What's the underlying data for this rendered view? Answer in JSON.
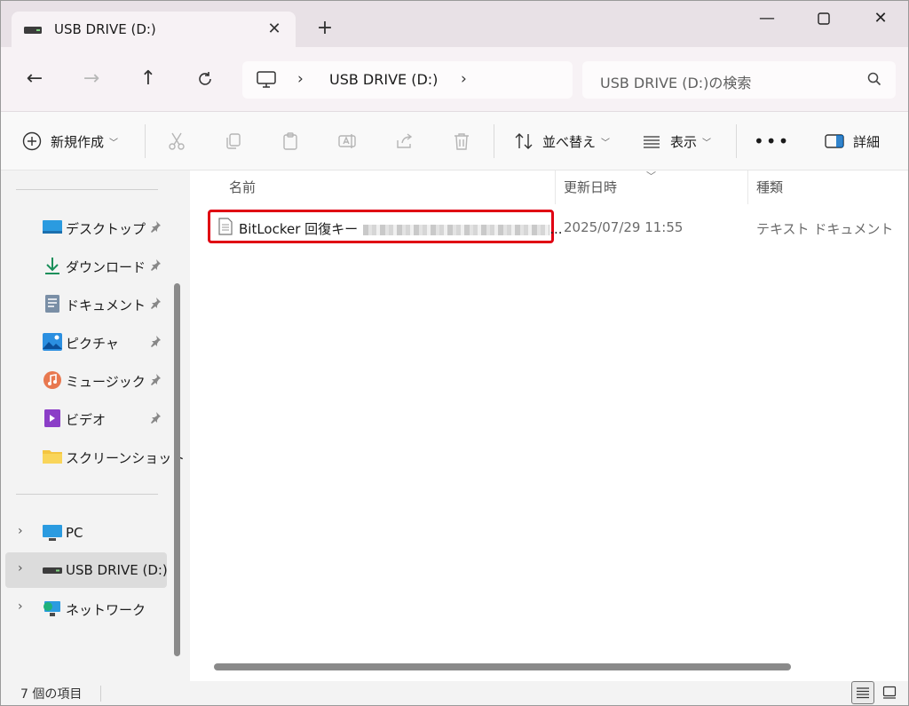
{
  "tab": {
    "title": "USB DRIVE (D:)"
  },
  "address": {
    "path": "USB DRIVE (D:)",
    "search_placeholder": "USB DRIVE (D:)の検索"
  },
  "toolbar": {
    "new": "新規作成",
    "sort": "並べ替え",
    "view": "表示",
    "details": "詳細"
  },
  "sidebar": {
    "quick": [
      {
        "label": "デスクトップ",
        "icon": "desktop-icon"
      },
      {
        "label": "ダウンロード",
        "icon": "download-icon"
      },
      {
        "label": "ドキュメント",
        "icon": "document-icon"
      },
      {
        "label": "ピクチャ",
        "icon": "pictures-icon"
      },
      {
        "label": "ミュージック",
        "icon": "music-icon"
      },
      {
        "label": "ビデオ",
        "icon": "video-icon"
      },
      {
        "label": "スクリーンショット",
        "icon": "folder-icon"
      }
    ],
    "pc": "PC",
    "usb": "USB DRIVE (D:)",
    "network": "ネットワーク"
  },
  "columns": {
    "name": "名前",
    "date": "更新日時",
    "type": "種類"
  },
  "files": [
    {
      "name": "BitLocker 回復キー",
      "name_suffix": "...",
      "date": "2025/07/29 11:55",
      "type": "テキスト ドキュメント"
    }
  ],
  "status": {
    "count": "7 個の項目"
  },
  "colors": {
    "highlight": "#e00012",
    "accent": "#0067c0"
  }
}
